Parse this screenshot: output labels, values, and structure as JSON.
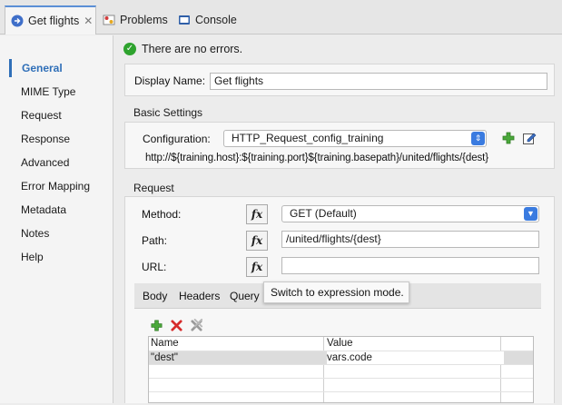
{
  "tabs": [
    {
      "label": "Get flights",
      "icon": "flow-icon",
      "active": true
    },
    {
      "label": "Problems",
      "icon": "problems-icon"
    },
    {
      "label": "Console",
      "icon": "console-icon"
    }
  ],
  "nav": {
    "items": [
      "General",
      "MIME Type",
      "Request",
      "Response",
      "Advanced",
      "Error Mapping",
      "Metadata",
      "Notes",
      "Help"
    ]
  },
  "status": {
    "text": "There are no errors."
  },
  "display": {
    "label": "Display Name:",
    "value": "Get flights"
  },
  "basic": {
    "title": "Basic Settings",
    "config_label": "Configuration:",
    "config_value": "HTTP_Request_config_training",
    "url": "http://${training.host}:${training.port}${training.basepath}/united/flights/{dest}"
  },
  "request": {
    "title": "Request",
    "method_label": "Method:",
    "method_value": "GET (Default)",
    "path_label": "Path:",
    "path_value": "/united/flights/{dest}",
    "url_label": "URL:",
    "url_value": "",
    "fx": "fx",
    "subtabs": [
      "Body",
      "Headers",
      "Query P"
    ],
    "tooltip": "Switch to expression mode."
  },
  "grid": {
    "columns": [
      "Name",
      "Value"
    ],
    "rows": [
      {
        "name": "\"dest\"",
        "value": "vars.code"
      }
    ]
  },
  "colors": {
    "accent": "#2f6fb8",
    "ok": "#2ea32e",
    "select": "#3a7be0"
  }
}
